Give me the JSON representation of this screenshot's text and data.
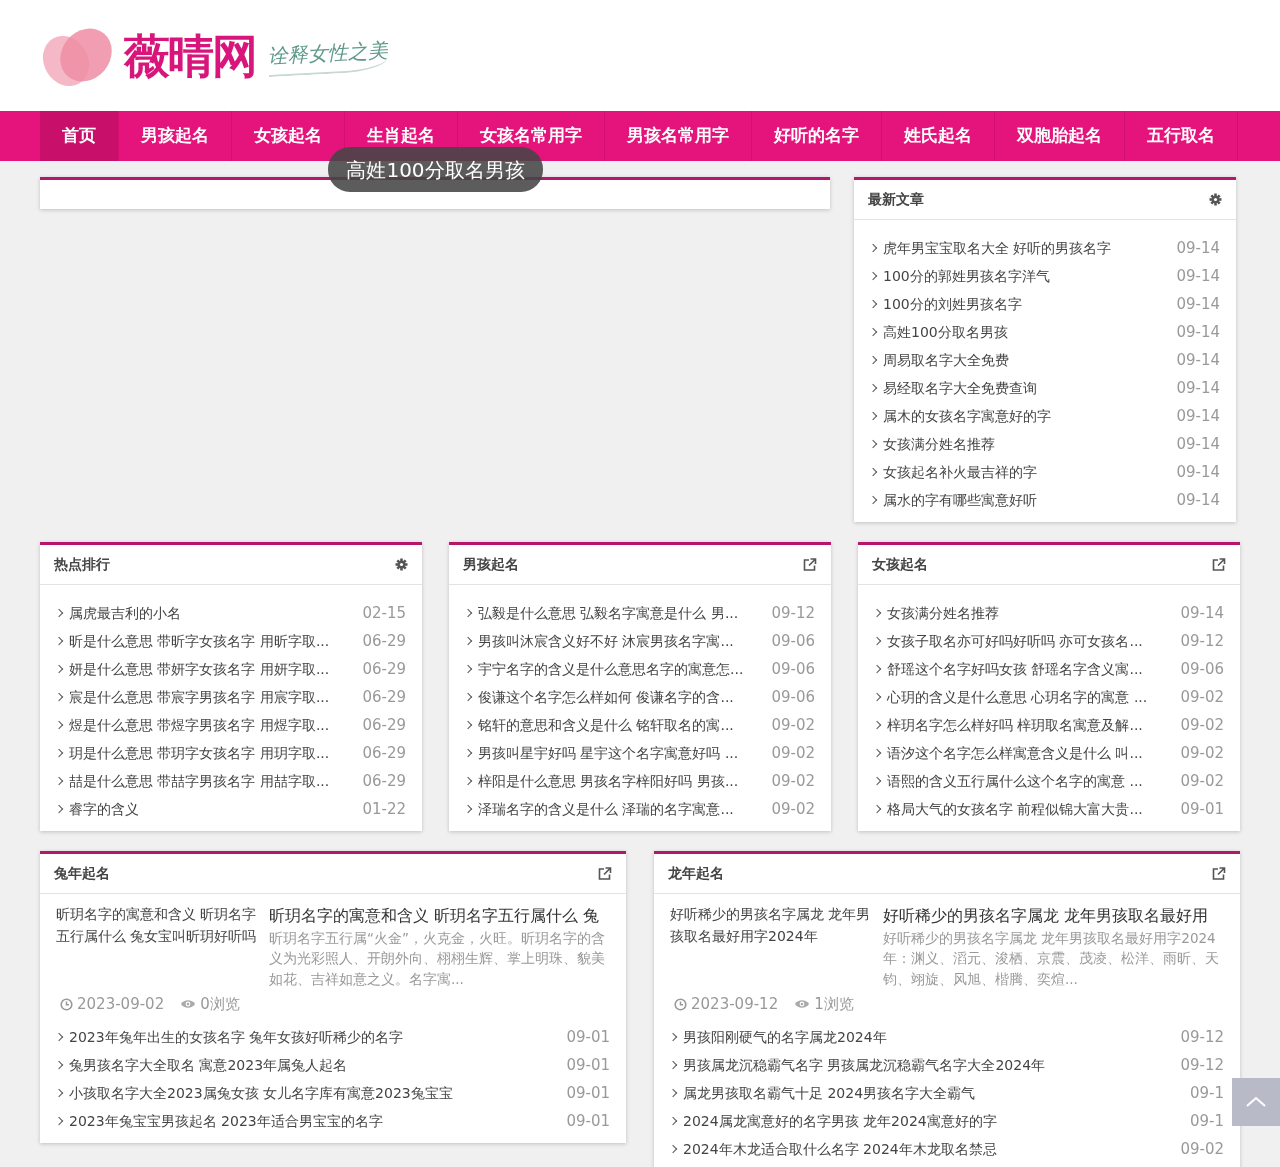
{
  "site": {
    "name": "薇晴网",
    "tagline": "诠释女性之美"
  },
  "nav": [
    {
      "label": "首页",
      "selected": true
    },
    {
      "label": "男孩起名",
      "selected": false
    },
    {
      "label": "女孩起名",
      "selected": false
    },
    {
      "label": "生肖起名",
      "selected": false
    },
    {
      "label": "女孩名常用字",
      "selected": false
    },
    {
      "label": "男孩名常用字",
      "selected": false
    },
    {
      "label": "好听的名字",
      "selected": false
    },
    {
      "label": "姓氏起名",
      "selected": false
    },
    {
      "label": "双胞胎起名",
      "selected": false
    },
    {
      "label": "五行取名",
      "selected": false
    }
  ],
  "tooltip": {
    "text": "高姓100分取名男孩"
  },
  "latest": {
    "title": "最新文章",
    "kind": "widget",
    "items": [
      {
        "title": "虎年男宝宝取名大全 好听的男孩名字",
        "date": "09-14"
      },
      {
        "title": "100分的郭姓男孩名字洋气",
        "date": "09-14"
      },
      {
        "title": "100分的刘姓男孩名字",
        "date": "09-14"
      },
      {
        "title": "高姓100分取名男孩",
        "date": "09-14"
      },
      {
        "title": "周易取名字大全免费",
        "date": "09-14"
      },
      {
        "title": "易经取名字大全免费查询",
        "date": "09-14"
      },
      {
        "title": "属木的女孩名字寓意好的字",
        "date": "09-14"
      },
      {
        "title": "女孩满分姓名推荐",
        "date": "09-14"
      },
      {
        "title": "女孩起名补火最吉祥的字",
        "date": "09-14"
      },
      {
        "title": "属水的字有哪些寓意好听",
        "date": "09-14"
      }
    ]
  },
  "middle": [
    {
      "title": "热点排行",
      "kind": "widget",
      "items": [
        {
          "title": "属虎最吉利的小名",
          "date": "02-15"
        },
        {
          "title": "昕是什么意思 带昕字女孩名字 用昕字取...",
          "date": "06-29"
        },
        {
          "title": "妍是什么意思 带妍字女孩名字 用妍字取...",
          "date": "06-29"
        },
        {
          "title": "宸是什么意思 带宸字男孩名字 用宸字取...",
          "date": "06-29"
        },
        {
          "title": "煜是什么意思 带煜字男孩名字 用煜字取...",
          "date": "06-29"
        },
        {
          "title": "玥是什么意思 带玥字女孩名字 用玥字取...",
          "date": "06-29"
        },
        {
          "title": "喆是什么意思 带喆字男孩名字 用喆字取...",
          "date": "06-29"
        },
        {
          "title": "睿字的含义",
          "date": "01-22"
        }
      ]
    },
    {
      "title": "男孩起名",
      "kind": "category",
      "items": [
        {
          "title": "弘毅是什么意思 弘毅名字寓意是什么 男...",
          "date": "09-12"
        },
        {
          "title": "男孩叫沐宸含义好不好 沐宸男孩名字寓...",
          "date": "09-06"
        },
        {
          "title": "宇宁名字的含义是什么意思名字的寓意怎...",
          "date": "09-06"
        },
        {
          "title": "俊谦这个名字怎么样如何 俊谦名字的含...",
          "date": "09-06"
        },
        {
          "title": "铭轩的意思和含义是什么 铭轩取名的寓...",
          "date": "09-02"
        },
        {
          "title": "男孩叫星宇好吗 星宇这个名字寓意好吗 ...",
          "date": "09-02"
        },
        {
          "title": "梓阳是什么意思 男孩名字梓阳好吗 男孩...",
          "date": "09-02"
        },
        {
          "title": "泽瑞名字的含义是什么 泽瑞的名字寓意...",
          "date": "09-02"
        }
      ]
    },
    {
      "title": "女孩起名",
      "kind": "category",
      "items": [
        {
          "title": "女孩满分姓名推荐",
          "date": "09-14"
        },
        {
          "title": "女孩子取名亦可好吗好听吗 亦可女孩名...",
          "date": "09-12"
        },
        {
          "title": "舒瑶这个名字好吗女孩 舒瑶名字含义寓...",
          "date": "09-06"
        },
        {
          "title": "心玥的含义是什么意思 心玥名字的寓意 ...",
          "date": "09-02"
        },
        {
          "title": "梓玥名字怎么样好吗 梓玥取名寓意及解...",
          "date": "09-02"
        },
        {
          "title": "语汐这个名字怎么样寓意含义是什么 叫...",
          "date": "09-02"
        },
        {
          "title": "语熙的含义五行属什么这个名字的寓意 ...",
          "date": "09-02"
        },
        {
          "title": "格局大气的女孩名字 前程似锦大富大贵...",
          "date": "09-01"
        }
      ]
    }
  ],
  "bottom": [
    {
      "title": "兔年起名",
      "kind": "category",
      "featured": {
        "image_alt": "昕玥名字的寓意和含义 昕玥名字五行属什么 兔女宝叫昕玥好听吗",
        "title": "昕玥名字的寓意和含义 昕玥名字五行属什么 兔",
        "summary": "昕玥名字五行属“火金”，火克金，火旺。昕玥名字的含义为光彩照人、开朗外向、栩栩生辉、掌上明珠、貌美如花、吉祥如意之义。名字寓...",
        "date": "2023-09-02",
        "views": "0浏览"
      },
      "items": [
        {
          "title": "2023年兔年出生的女孩名字 兔年女孩好听稀少的名字",
          "date": "09-01"
        },
        {
          "title": "兔男孩名字大全取名 寓意2023年属兔人起名",
          "date": "09-01"
        },
        {
          "title": "小孩取名字大全2023属兔女孩 女儿名字库有寓意2023兔宝宝",
          "date": "09-01"
        },
        {
          "title": "2023年兔宝宝男孩起名 2023年适合男宝宝的名字",
          "date": "09-01"
        }
      ]
    },
    {
      "title": "龙年起名",
      "kind": "category",
      "featured": {
        "image_alt": "好听稀少的男孩名字属龙 龙年男孩取名最好用字2024年",
        "title": "好听稀少的男孩名字属龙 龙年男孩取名最好用",
        "summary": "好听稀少的男孩名字属龙 龙年男孩取名最好用字2024年：渊义、滔元、浚栖、京震、茂凌、松洋、雨昕、天钧、翊旋、风旭、楷腾、奕煊...",
        "date": "2023-09-12",
        "views": "1浏览"
      },
      "items": [
        {
          "title": "男孩阳刚硬气的名字属龙2024年",
          "date": "09-12"
        },
        {
          "title": "男孩属龙沉稳霸气名字 男孩属龙沉稳霸气名字大全2024年",
          "date": "09-12"
        },
        {
          "title": "属龙男孩取名霸气十足 2024男孩名字大全霸气",
          "date": "09-1"
        },
        {
          "title": "2024属龙寓意好的名字男孩 龙年2024寓意好的字",
          "date": "09-1"
        },
        {
          "title": "2024年木龙适合取什么名字 2024年木龙取名禁忌",
          "date": "09-02"
        }
      ]
    }
  ]
}
